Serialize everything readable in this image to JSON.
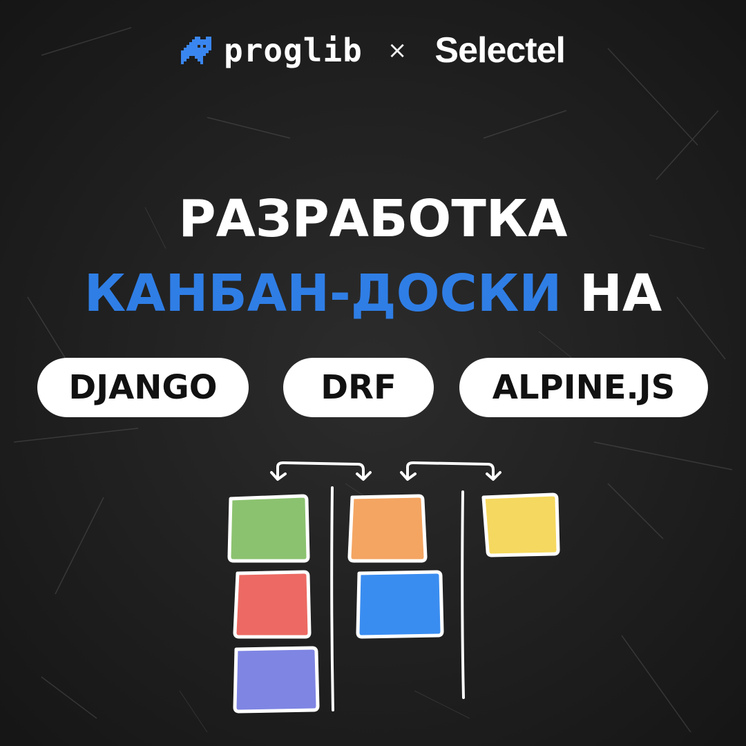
{
  "header": {
    "proglib_text": "proglib",
    "separator": "×",
    "selectel_text": "Selectel",
    "proglib_logo_icon": "pixel-creature-icon"
  },
  "title": {
    "line1": "РАЗРАБОТКА",
    "line2_highlight": "КАНБАН-ДОСКИ",
    "line2_rest": "НА"
  },
  "tags": [
    {
      "label": "DJANGO"
    },
    {
      "label": "DRF"
    },
    {
      "label": "ALPINE.JS"
    }
  ],
  "colors": {
    "background": "#232323",
    "accent_blue": "#2f7ee6",
    "text": "#ffffff",
    "card_green": "#8bc26f",
    "card_red": "#ec6a63",
    "card_purple": "#7f85e3",
    "card_orange": "#f4a562",
    "card_blue": "#3a8df0",
    "card_yellow": "#f5d85f"
  }
}
